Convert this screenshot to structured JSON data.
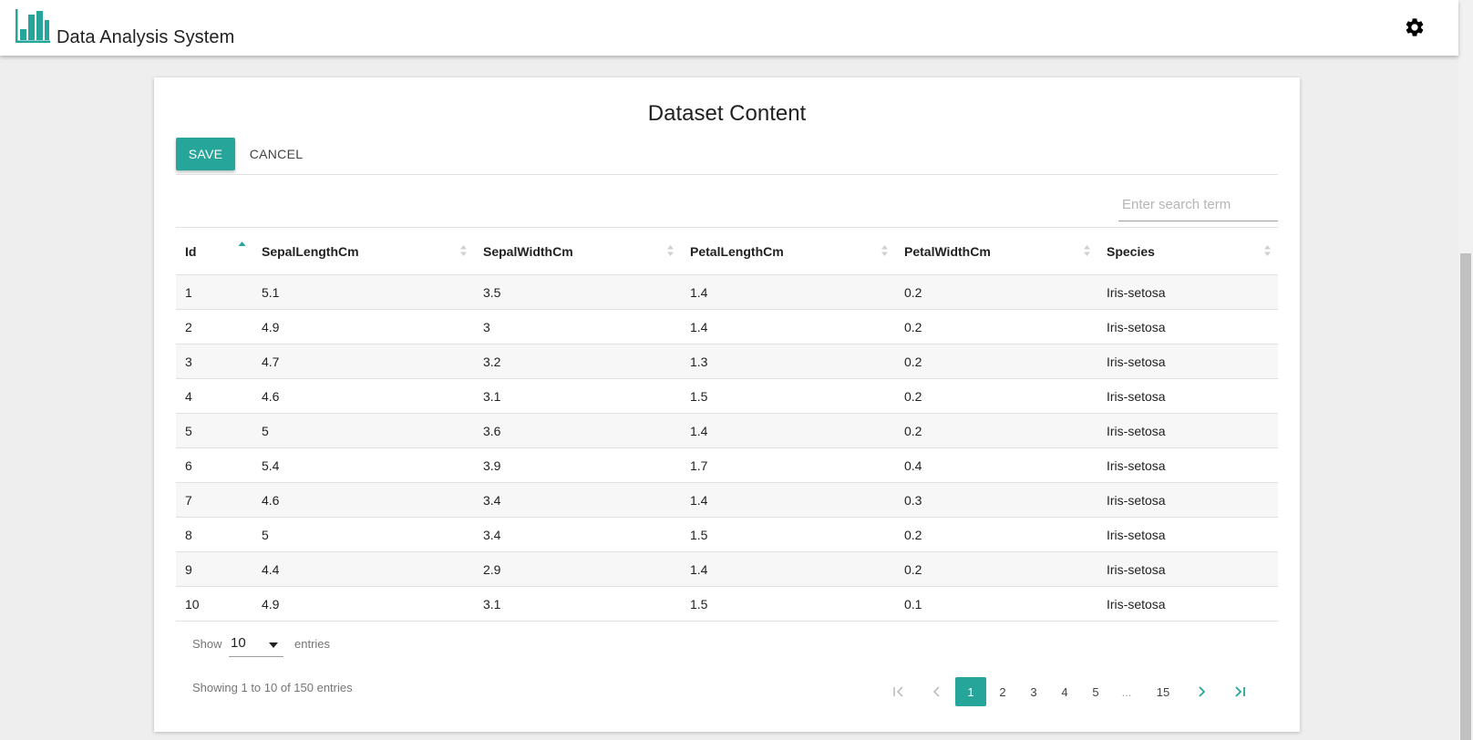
{
  "header": {
    "app_title": "Data Analysis System",
    "logo_icon": "bar-chart-icon",
    "settings_icon": "gear-icon"
  },
  "card": {
    "title": "Dataset Content",
    "save_label": "SAVE",
    "cancel_label": "CANCEL",
    "search_placeholder": "Enter search term"
  },
  "table": {
    "columns": [
      "Id",
      "SepalLengthCm",
      "SepalWidthCm",
      "PetalLengthCm",
      "PetalWidthCm",
      "Species"
    ],
    "sort_column": "Id",
    "sort_direction": "ascending",
    "rows": [
      [
        "1",
        "5.1",
        "3.5",
        "1.4",
        "0.2",
        "Iris-setosa"
      ],
      [
        "2",
        "4.9",
        "3",
        "1.4",
        "0.2",
        "Iris-setosa"
      ],
      [
        "3",
        "4.7",
        "3.2",
        "1.3",
        "0.2",
        "Iris-setosa"
      ],
      [
        "4",
        "4.6",
        "3.1",
        "1.5",
        "0.2",
        "Iris-setosa"
      ],
      [
        "5",
        "5",
        "3.6",
        "1.4",
        "0.2",
        "Iris-setosa"
      ],
      [
        "6",
        "5.4",
        "3.9",
        "1.7",
        "0.4",
        "Iris-setosa"
      ],
      [
        "7",
        "4.6",
        "3.4",
        "1.4",
        "0.3",
        "Iris-setosa"
      ],
      [
        "8",
        "5",
        "3.4",
        "1.5",
        "0.2",
        "Iris-setosa"
      ],
      [
        "9",
        "4.4",
        "2.9",
        "1.4",
        "0.2",
        "Iris-setosa"
      ],
      [
        "10",
        "4.9",
        "3.1",
        "1.5",
        "0.1",
        "Iris-setosa"
      ]
    ]
  },
  "footer": {
    "show_label": "Show",
    "page_size": "10",
    "entries_label": "entries",
    "info": "Showing 1 to 10 of 150 entries"
  },
  "pagination": {
    "pages": [
      "1",
      "2",
      "3",
      "4",
      "5"
    ],
    "ellipsis": "...",
    "last_page": "15",
    "current_page": "1"
  },
  "colors": {
    "accent": "#26a69a",
    "stripe": "#f7f7f7"
  }
}
